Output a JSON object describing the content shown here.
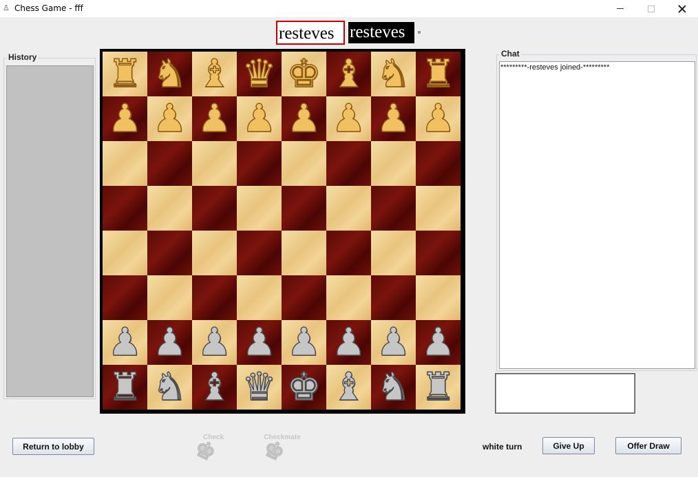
{
  "window": {
    "title": "Chess Game - fff",
    "app_icon": "chess-app-icon",
    "controls": [
      "minimize-icon",
      "maximize-icon",
      "close-icon"
    ]
  },
  "players": {
    "white_name": "resteves",
    "black_name": "resteves"
  },
  "history": {
    "label": "History",
    "moves": []
  },
  "chat": {
    "label": "Chat",
    "messages": [
      "*********-resteves joined-*********"
    ],
    "input_value": ""
  },
  "board": {
    "light_color": "#f1d59a",
    "dark_color": "#6a1109",
    "rows": [
      [
        {
          "p": "♜",
          "c": "w"
        },
        {
          "p": "♞",
          "c": "w"
        },
        {
          "p": "♝",
          "c": "w"
        },
        {
          "p": "♛",
          "c": "w"
        },
        {
          "p": "♚",
          "c": "w"
        },
        {
          "p": "♝",
          "c": "w"
        },
        {
          "p": "♞",
          "c": "w"
        },
        {
          "p": "♜",
          "c": "w"
        }
      ],
      [
        {
          "p": "♟",
          "c": "w"
        },
        {
          "p": "♟",
          "c": "w"
        },
        {
          "p": "♟",
          "c": "w"
        },
        {
          "p": "♟",
          "c": "w"
        },
        {
          "p": "♟",
          "c": "w"
        },
        {
          "p": "♟",
          "c": "w"
        },
        {
          "p": "♟",
          "c": "w"
        },
        {
          "p": "♟",
          "c": "w"
        }
      ],
      [
        null,
        null,
        null,
        null,
        null,
        null,
        null,
        null
      ],
      [
        null,
        null,
        null,
        null,
        null,
        null,
        null,
        null
      ],
      [
        null,
        null,
        null,
        null,
        null,
        null,
        null,
        null
      ],
      [
        null,
        null,
        null,
        null,
        null,
        null,
        null,
        null
      ],
      [
        {
          "p": "♟",
          "c": "b"
        },
        {
          "p": "♟",
          "c": "b"
        },
        {
          "p": "♟",
          "c": "b"
        },
        {
          "p": "♟",
          "c": "b"
        },
        {
          "p": "♟",
          "c": "b"
        },
        {
          "p": "♟",
          "c": "b"
        },
        {
          "p": "♟",
          "c": "b"
        },
        {
          "p": "♟",
          "c": "b"
        }
      ],
      [
        {
          "p": "♜",
          "c": "b"
        },
        {
          "p": "♞",
          "c": "b"
        },
        {
          "p": "♝",
          "c": "b"
        },
        {
          "p": "♛",
          "c": "b"
        },
        {
          "p": "♚",
          "c": "b"
        },
        {
          "p": "♝",
          "c": "b"
        },
        {
          "p": "♞",
          "c": "b"
        },
        {
          "p": "♜",
          "c": "b"
        }
      ]
    ]
  },
  "status": {
    "check_label": "Check",
    "checkmate_label": "Checkmate",
    "turn_text": "white turn"
  },
  "buttons": {
    "return_lobby": "Return to lobby",
    "give_up": "Give Up",
    "offer_draw": "Offer Draw"
  }
}
